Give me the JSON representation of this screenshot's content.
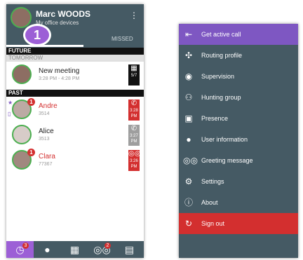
{
  "user": {
    "name": "Marc WOODS",
    "subtitle": "My office devices",
    "badge_step": "1"
  },
  "tabs": {
    "missed_label": "MISSED"
  },
  "sections": {
    "future": "FUTURE",
    "tomorrow": "TOMORROW",
    "past": "PAST"
  },
  "future_items": [
    {
      "title": "New meeting",
      "subtitle": "3:28 PM - 4:28 PM",
      "tile_line1": "5/7",
      "tile_color": "#111111",
      "tile_glyph": "calendar-icon"
    }
  ],
  "past_items": [
    {
      "title": "Andre",
      "subtitle": "3514",
      "time": "3:28\nPM",
      "tile_color": "#d32f2f",
      "badge": "1",
      "red": true,
      "icon": "phone-outgoing-icon"
    },
    {
      "title": "Alice",
      "subtitle": "3513",
      "time": "3:27\nPM",
      "tile_color": "#9e9e9e",
      "badge": "",
      "red": false,
      "icon": "phone-incoming-icon"
    },
    {
      "title": "Clara",
      "subtitle": "77367",
      "time": "3:26\nPM",
      "tile_color": "#d32f2f",
      "badge": "1",
      "red": true,
      "icon": "voicemail-icon"
    }
  ],
  "bottom_tabs": [
    {
      "icon": "history-icon",
      "badge": "3",
      "active": true
    },
    {
      "icon": "contact-icon",
      "badge": "",
      "active": false
    },
    {
      "icon": "dialpad-icon",
      "badge": "",
      "active": false
    },
    {
      "icon": "voicemail-icon",
      "badge": "2",
      "active": false
    },
    {
      "icon": "deskphone-icon",
      "badge": "",
      "active": false
    }
  ],
  "menu": [
    {
      "label": "Get active call",
      "icon": "get-active-call-icon",
      "active": true
    },
    {
      "label": "Routing profile",
      "icon": "routing-icon"
    },
    {
      "label": "Supervision",
      "icon": "eye-icon"
    },
    {
      "label": "Hunting group",
      "icon": "group-icon"
    },
    {
      "label": "Presence",
      "icon": "presence-icon"
    },
    {
      "label": "User information",
      "icon": "user-icon"
    },
    {
      "label": "Greeting message",
      "icon": "voicemail-icon"
    },
    {
      "label": "Settings",
      "icon": "gear-icon"
    },
    {
      "label": "About",
      "icon": "info-icon"
    },
    {
      "label": "Sign out",
      "icon": "sign-out-icon",
      "danger": true
    }
  ],
  "colors": {
    "header": "#455a64",
    "accent": "#9c5fd6",
    "danger": "#d32f2f",
    "green_ring": "#4caf50"
  }
}
